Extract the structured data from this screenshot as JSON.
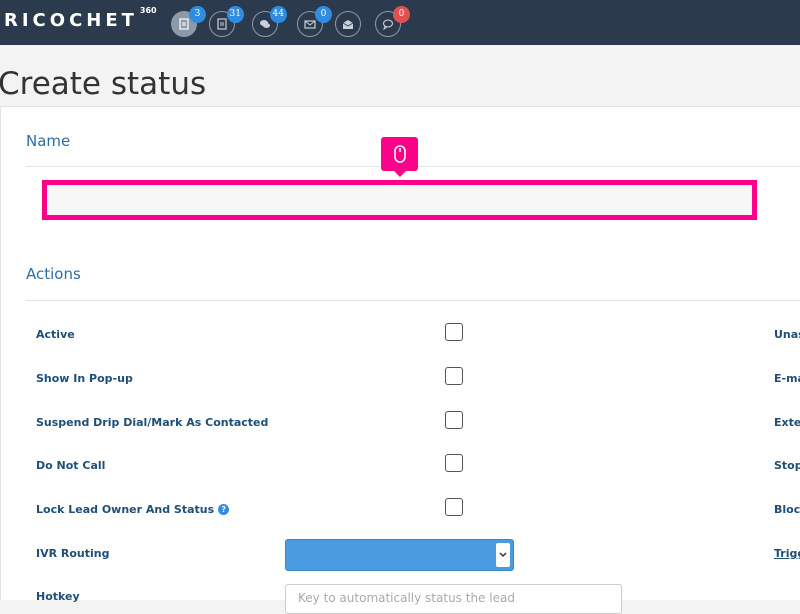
{
  "app": {
    "logo": "RICOCHET",
    "logo_sup": "360"
  },
  "nav": {
    "icons": [
      {
        "name": "lead-icon",
        "badge": "3"
      },
      {
        "name": "document-icon",
        "badge": "31"
      },
      {
        "name": "chat-icon",
        "badge": "44"
      },
      {
        "name": "mail-icon",
        "badge": "0"
      },
      {
        "name": "open-mail-icon",
        "badge": ""
      },
      {
        "name": "comment-icon",
        "badge": "0"
      }
    ]
  },
  "page": {
    "title": "Create status"
  },
  "name_section": {
    "title": "Name",
    "value": ""
  },
  "actions_section": {
    "title": "Actions",
    "rows": [
      {
        "label": "Active",
        "checked": false
      },
      {
        "label": "Show In Pop-up",
        "checked": false
      },
      {
        "label": "Suspend Drip Dial/Mark As Contacted",
        "checked": false
      },
      {
        "label": "Do Not Call",
        "checked": false
      },
      {
        "label": "Lock Lead Owner And Status",
        "checked": false
      },
      {
        "label": "IVR Routing",
        "selected": ""
      },
      {
        "label": "Hotkey",
        "placeholder": "Key to automatically status the lead"
      }
    ],
    "right_labels": [
      "Unas",
      "E-ma",
      "Exter",
      "Stop",
      "Block",
      "Trigg"
    ]
  },
  "colors": {
    "topbar": "#2c3a4d",
    "accent": "#ff0088",
    "badge_blue": "#2f8ce0",
    "badge_red": "#e05252",
    "select": "#4a9ce0"
  }
}
